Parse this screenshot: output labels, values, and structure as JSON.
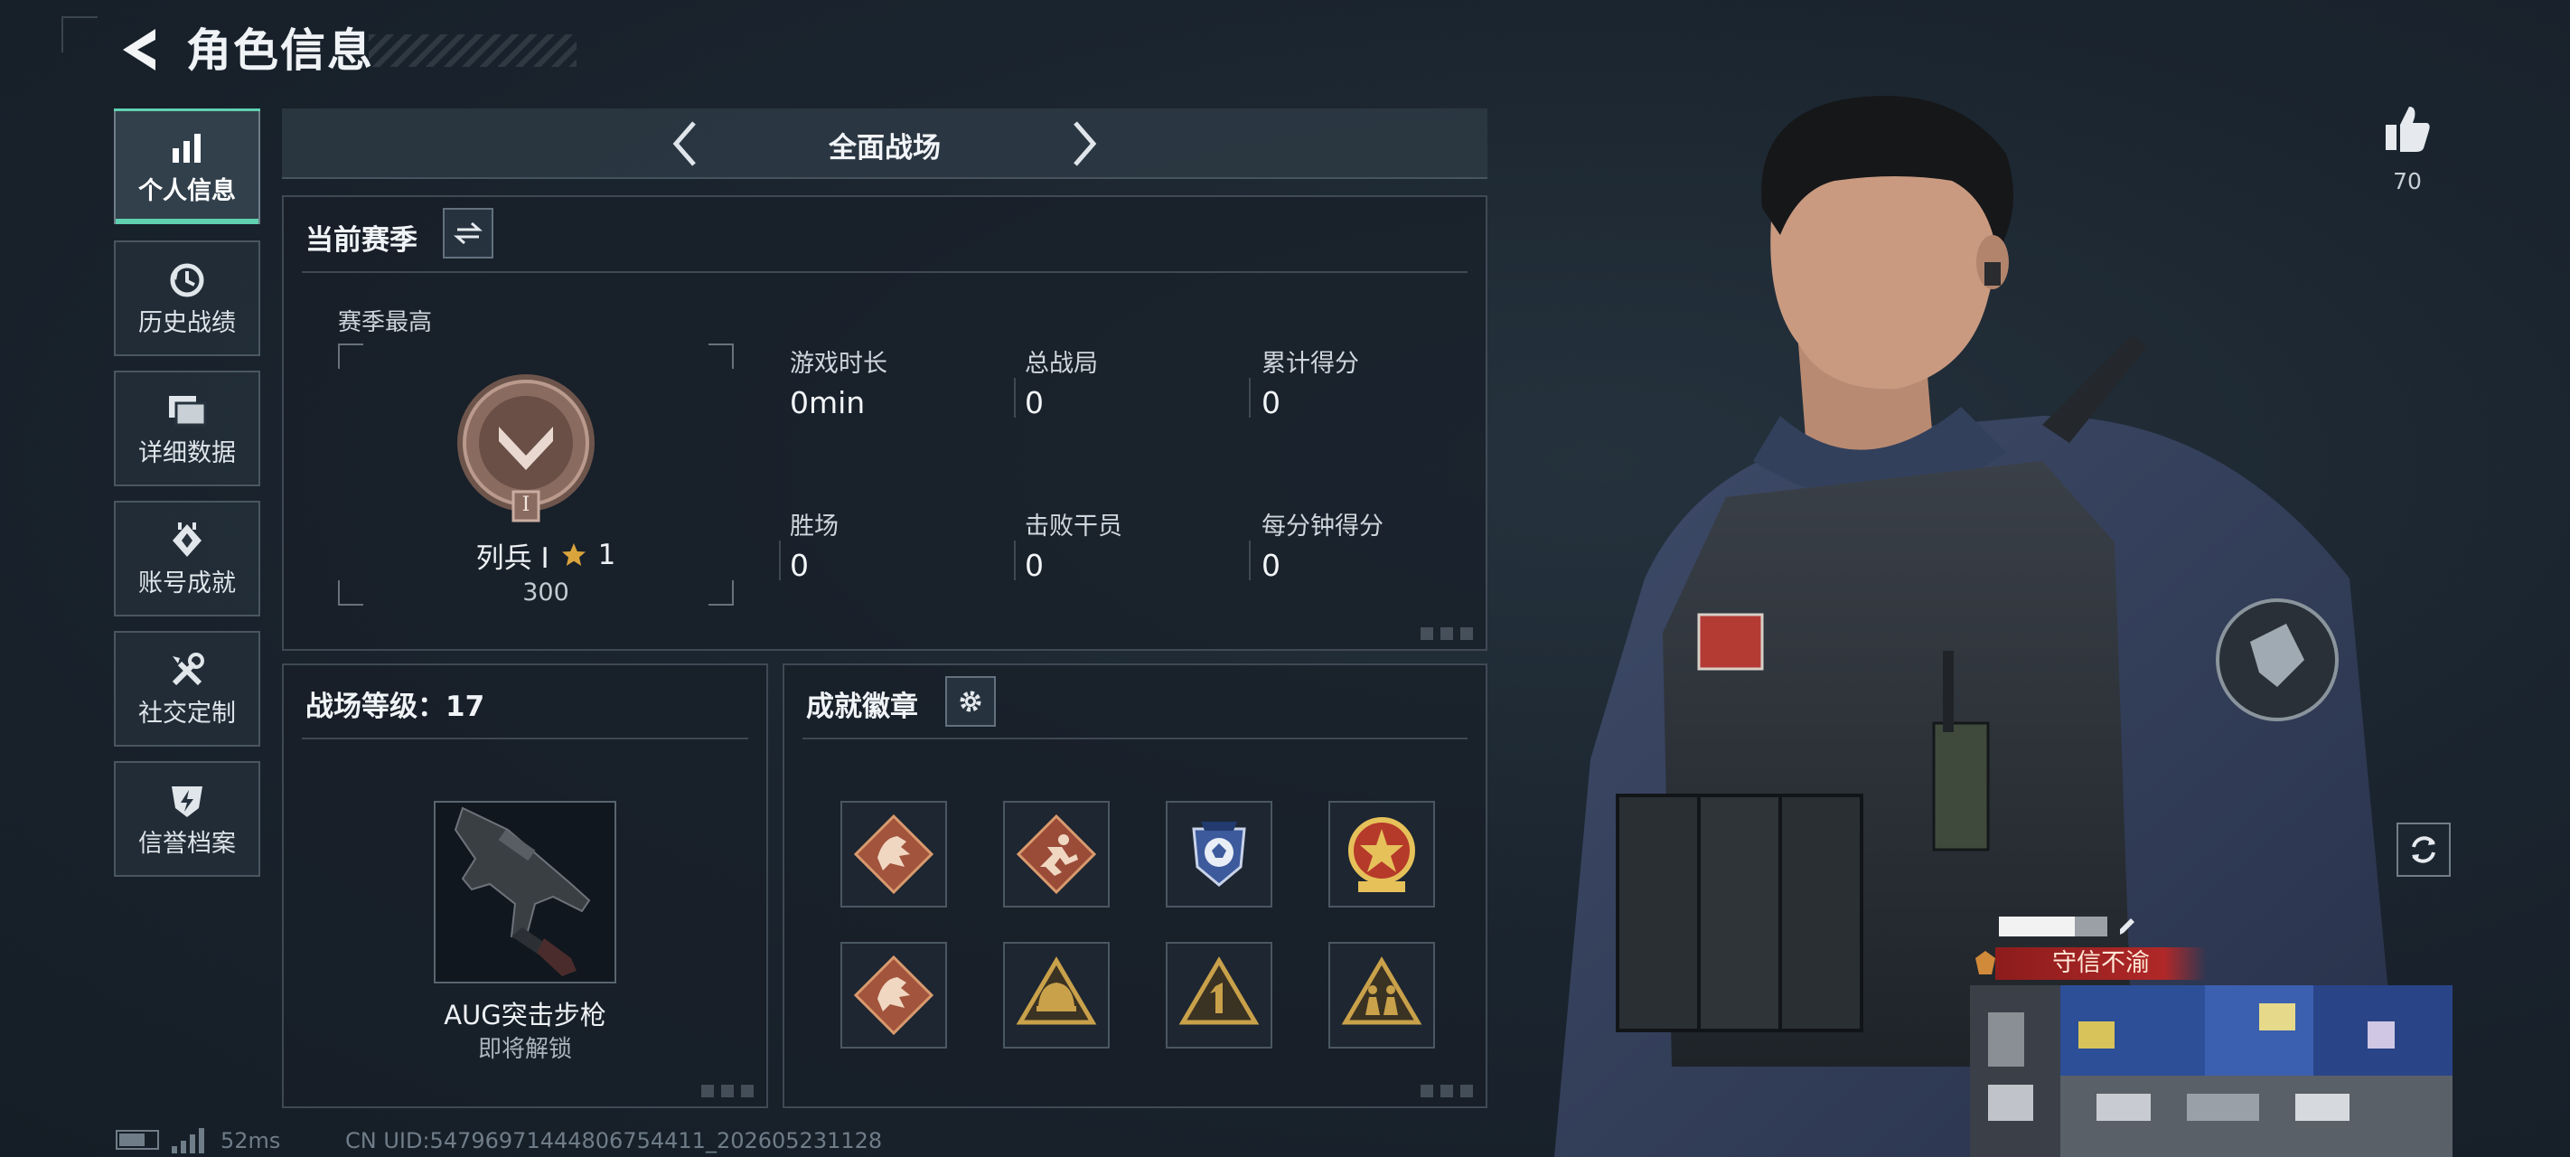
{
  "header": {
    "title": "角色信息"
  },
  "nav": [
    {
      "label": "个人信息",
      "icon": "bar-chart-icon",
      "active": true
    },
    {
      "label": "历史战绩",
      "icon": "history-clock-icon",
      "active": false
    },
    {
      "label": "详细数据",
      "icon": "folder-stack-icon",
      "active": false
    },
    {
      "label": "账号成就",
      "icon": "achievement-icon",
      "active": false
    },
    {
      "label": "社交定制",
      "icon": "tools-icon",
      "active": false
    },
    {
      "label": "信誉档案",
      "icon": "shield-bolt-icon",
      "active": false
    }
  ],
  "mode": {
    "title": "全面战场"
  },
  "season": {
    "title": "当前赛季",
    "best_label": "赛季最高",
    "rank_name": "列兵 Ⅰ",
    "rank_stars": "1",
    "rank_points": "300",
    "rank_emblem_numeral": "I",
    "stats": [
      {
        "label": "游戏时长",
        "value": "0min"
      },
      {
        "label": "总战局",
        "value": "0"
      },
      {
        "label": "累计得分",
        "value": "0"
      },
      {
        "label": "胜场",
        "value": "0"
      },
      {
        "label": "击败干员",
        "value": "0"
      },
      {
        "label": "每分钟得分",
        "value": "0"
      }
    ]
  },
  "battlefield_level": {
    "title": "战场等级：17",
    "weapon_name": "AUG突击步枪",
    "weapon_status": "即将解锁"
  },
  "badges": {
    "title": "成就徽章",
    "items": [
      {
        "icon": "dragon-badge-icon",
        "color": "#a2543c"
      },
      {
        "icon": "runner-badge-icon",
        "color": "#9a4c38"
      },
      {
        "icon": "shield-wolf-badge-icon",
        "color": "#3c5a9c"
      },
      {
        "icon": "star-medal-badge-icon",
        "color": "#b63a2a"
      },
      {
        "icon": "dragon-badge-icon",
        "color": "#a2543c"
      },
      {
        "icon": "helmet-badge-icon",
        "color": "#c9a14a"
      },
      {
        "icon": "number-one-badge-icon",
        "color": "#c9a14a"
      },
      {
        "icon": "soldiers-badge-icon",
        "color": "#c9a14a"
      }
    ]
  },
  "footer": {
    "ping": "52ms",
    "uid": "CN UID:5479697144480675441‍1_202605231128"
  },
  "profile": {
    "likes": "70",
    "honor_tag": "守信不渝"
  },
  "colors": {
    "accent": "#5fd0b0",
    "tag_red": "#b02828"
  }
}
